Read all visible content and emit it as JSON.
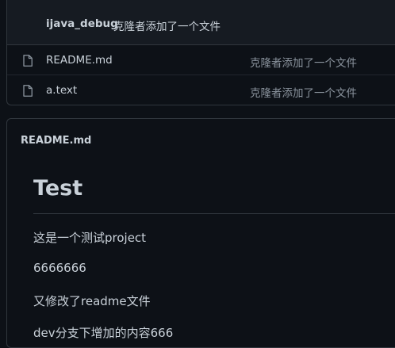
{
  "latest_commit": {
    "author": "ijava_debug",
    "message": "克隆者添加了一个文件"
  },
  "files": [
    {
      "name": "README.md",
      "commit_message": "克隆者添加了一个文件",
      "icon": "file-icon"
    },
    {
      "name": "a.text",
      "commit_message": "克隆者添加了一个文件",
      "icon": "file-icon"
    }
  ],
  "readme": {
    "title": "README.md",
    "heading": "Test",
    "paragraphs": [
      "这是一个测试project",
      "6666666",
      "又修改了readme文件",
      "dev分支下增加的内容666"
    ]
  }
}
